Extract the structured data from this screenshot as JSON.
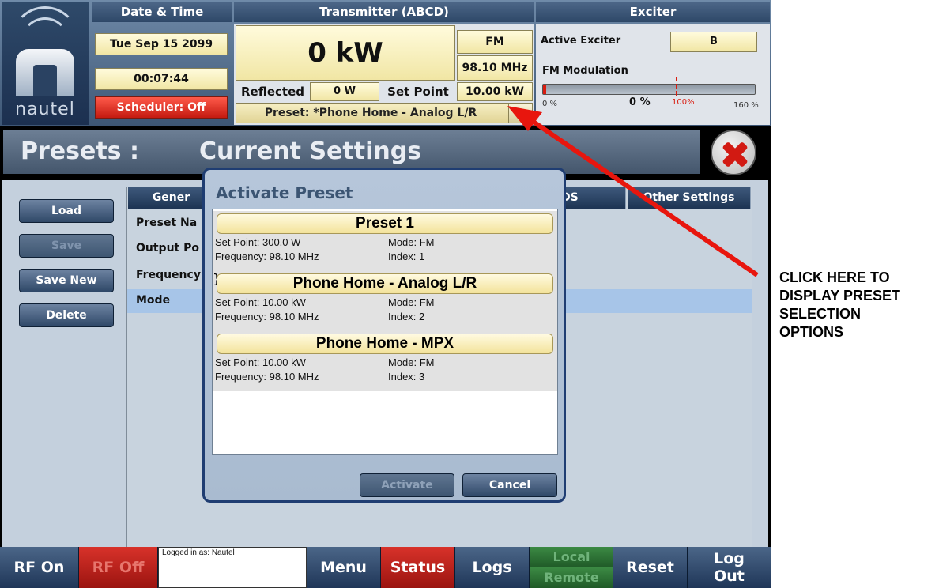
{
  "header": {
    "logo_text": "nautel",
    "date_time_title": "Date & Time",
    "date": "Tue Sep 15 2099",
    "time": "00:07:44",
    "scheduler": "Scheduler: Off",
    "transmitter_title": "Transmitter (ABCD)",
    "power": "0 kW",
    "band": "FM",
    "frequency": "98.10 MHz",
    "reflected_label": "Reflected",
    "reflected_value": "0 W",
    "set_point_label": "Set Point",
    "set_point_value": "10.00 kW",
    "preset_dropdown": "Preset: *Phone Home - Analog L/R",
    "exciter_title": "Exciter",
    "active_exciter_label": "Active Exciter",
    "active_exciter_value": "B",
    "fm_modulation_label": "FM Modulation",
    "fm_modulation_value": "0 %",
    "fm_modulation_level": 0.0,
    "scale_min": "0 %",
    "scale_mid": "100%",
    "scale_max": "160 %"
  },
  "page": {
    "title_left": "Presets :",
    "title_right": "Current Settings"
  },
  "sidebar": {
    "load": "Load",
    "save": "Save",
    "save_new": "Save New",
    "delete": "Delete"
  },
  "tabs": {
    "general": "Gener",
    "ds": "DS",
    "other": "Other Settings"
  },
  "settings_rows": {
    "preset_name": "Preset Na",
    "output_power": "Output Po",
    "frequency": "Frequency",
    "mode": "Mode"
  },
  "dialog": {
    "title": "Activate Preset",
    "presets": [
      {
        "name": "Preset 1",
        "set_point": "Set Point: 300.0 W",
        "mode": "Mode: FM",
        "frequency": "Frequency: 98.10 MHz",
        "index": "Index: 1"
      },
      {
        "name": "Phone Home - Analog L/R",
        "set_point": "Set Point: 10.00 kW",
        "mode": "Mode: FM",
        "frequency": "Frequency: 98.10 MHz",
        "index": "Index: 2"
      },
      {
        "name": "Phone Home - MPX",
        "set_point": "Set Point: 10.00 kW",
        "mode": "Mode: FM",
        "frequency": "Frequency: 98.10 MHz",
        "index": "Index: 3"
      }
    ],
    "activate": "Activate",
    "cancel": "Cancel"
  },
  "bottom": {
    "rf_on": "RF On",
    "rf_off": "RF Off",
    "logged_in": "Logged in as: Nautel",
    "menu": "Menu",
    "status": "Status",
    "logs": "Logs",
    "local": "Local",
    "remote": "Remote",
    "reset": "Reset",
    "logout": "Log Out"
  },
  "annotation": {
    "line1": "CLICK HERE TO",
    "line2": "DISPLAY PRESET",
    "line3": "SELECTION",
    "line4": "OPTIONS"
  },
  "colors": {
    "accent_red": "#e8160e",
    "status_red": "#e23a2a",
    "highlight_yellow": "#f6ecb0"
  }
}
